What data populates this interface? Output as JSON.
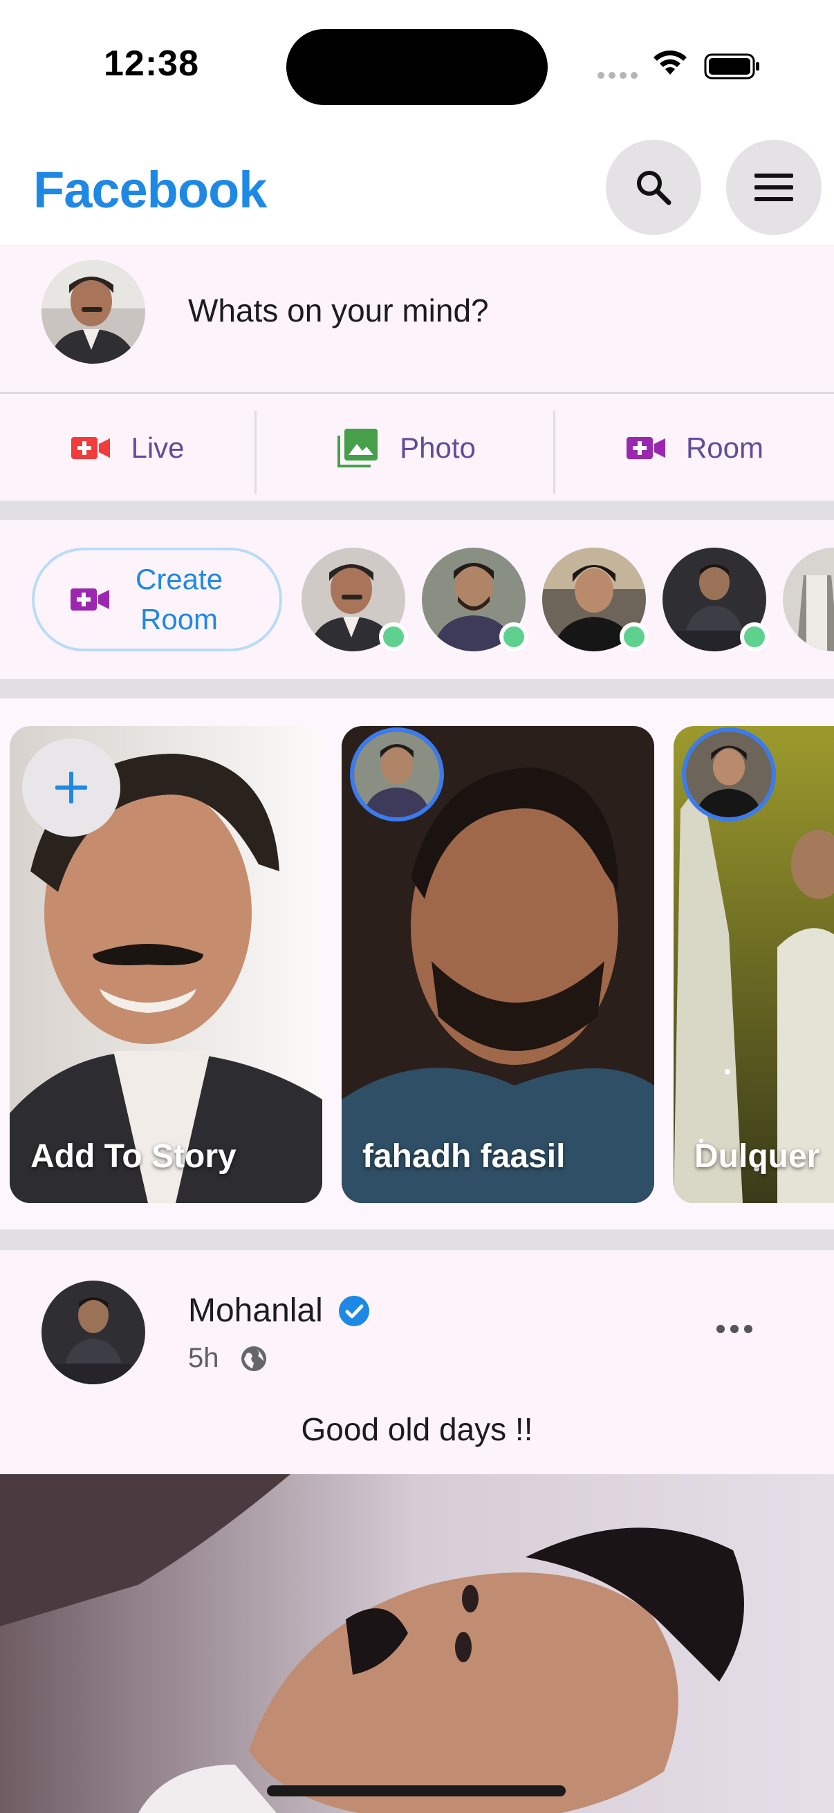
{
  "status_bar": {
    "time": "12:38"
  },
  "header": {
    "brand": "Facebook",
    "search_icon": "search-icon",
    "menu_icon": "menu-icon"
  },
  "composer": {
    "prompt": "Whats on your mind?"
  },
  "actions": [
    {
      "label": "Live",
      "icon": "live-video-icon",
      "color": "#f23b3b"
    },
    {
      "label": "Photo",
      "icon": "photo-library-icon",
      "color": "#45a049"
    },
    {
      "label": "Room",
      "icon": "video-room-icon",
      "color": "#9b27b0"
    }
  ],
  "rooms": {
    "create_label_line1": "Create",
    "create_label_line2": "Room"
  },
  "stories": [
    {
      "name": "Add To Story"
    },
    {
      "name": "fahadh faasil"
    },
    {
      "name": "Dulquer"
    }
  ],
  "post": {
    "author": "Mohanlal",
    "verified": true,
    "time": "5h",
    "caption": "Good old days !!"
  },
  "colors": {
    "brand": "#1e88e5",
    "online": "#5ed18e",
    "story_ring": "#3a7bf0",
    "label": "#5e4d9a"
  }
}
